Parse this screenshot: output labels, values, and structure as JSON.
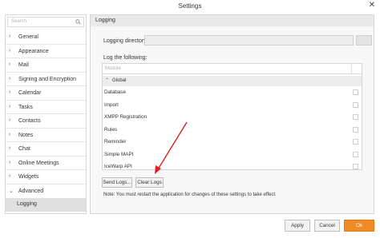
{
  "window": {
    "title": "Settings",
    "close_glyph": "✕"
  },
  "sidebar": {
    "search_placeholder": "Search",
    "items": [
      {
        "label": "General",
        "chevron": "›"
      },
      {
        "label": "Appearance",
        "chevron": "›"
      },
      {
        "label": "Mail",
        "chevron": "›"
      },
      {
        "label": "Signing and Encryption",
        "chevron": "›"
      },
      {
        "label": "Calendar",
        "chevron": "›"
      },
      {
        "label": "Tasks",
        "chevron": "›"
      },
      {
        "label": "Contacts",
        "chevron": "›"
      },
      {
        "label": "Notes",
        "chevron": "›"
      },
      {
        "label": "Chat",
        "chevron": "›"
      },
      {
        "label": "Online Meetings",
        "chevron": "›"
      },
      {
        "label": "Widgets",
        "chevron": "›"
      },
      {
        "label": "Advanced",
        "chevron": "⌄"
      }
    ],
    "selected_sub": "Logging"
  },
  "panel": {
    "header": "Logging",
    "directory_label": "Logging directory:",
    "directory_value": "",
    "log_following_label": "Log the following:",
    "list_header": "Module",
    "group_label": "Global",
    "group_chevron": "⌃",
    "modules": [
      "Database",
      "Import",
      "XMPP Registration",
      "Rules",
      "Reminder",
      "Simple MAPI",
      "IceWarp API"
    ],
    "send_logs": "Send Logs...",
    "clear_logs": "Clear Logs",
    "note": "Note: You must restart the application for changes of these settings to take effect."
  },
  "footer": {
    "apply": "Apply",
    "cancel": "Cancel",
    "ok": "Ok"
  },
  "colors": {
    "accent": "#f08a24",
    "annotation_arrow": "#e02020"
  },
  "icons": {
    "search": "search-icon",
    "close": "close-icon",
    "chevron": "chevron-icon"
  }
}
